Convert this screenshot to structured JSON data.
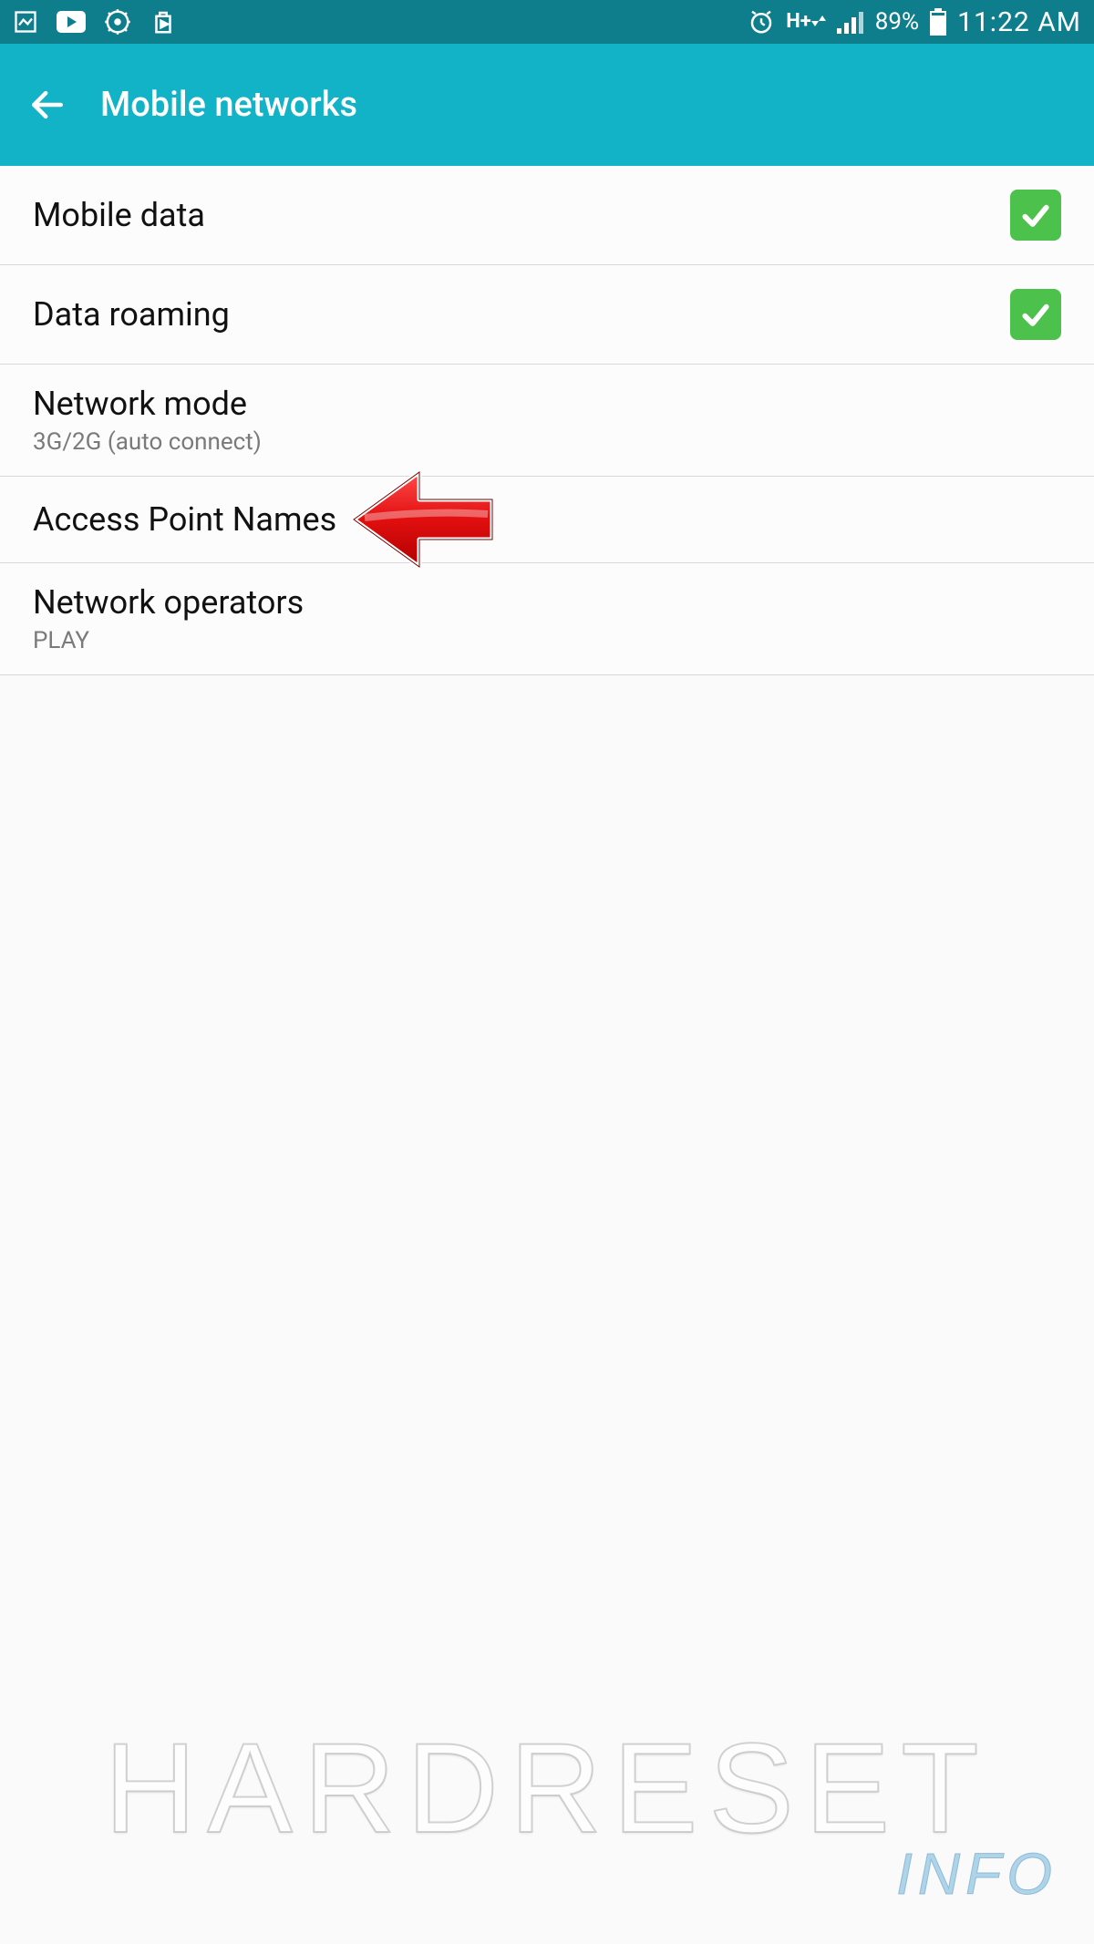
{
  "status_bar": {
    "battery_pct": "89%",
    "time": "11:22 AM",
    "network_label": "H+"
  },
  "app_bar": {
    "title": "Mobile networks"
  },
  "settings": [
    {
      "label": "Mobile data",
      "checked": true
    },
    {
      "label": "Data roaming",
      "checked": true
    },
    {
      "label": "Network mode",
      "sub": "3G/2G (auto connect)"
    },
    {
      "label": "Access Point Names"
    },
    {
      "label": "Network operators",
      "sub": "PLAY"
    }
  ],
  "watermark": {
    "main": "HARDRESET",
    "sub": "INFO"
  }
}
